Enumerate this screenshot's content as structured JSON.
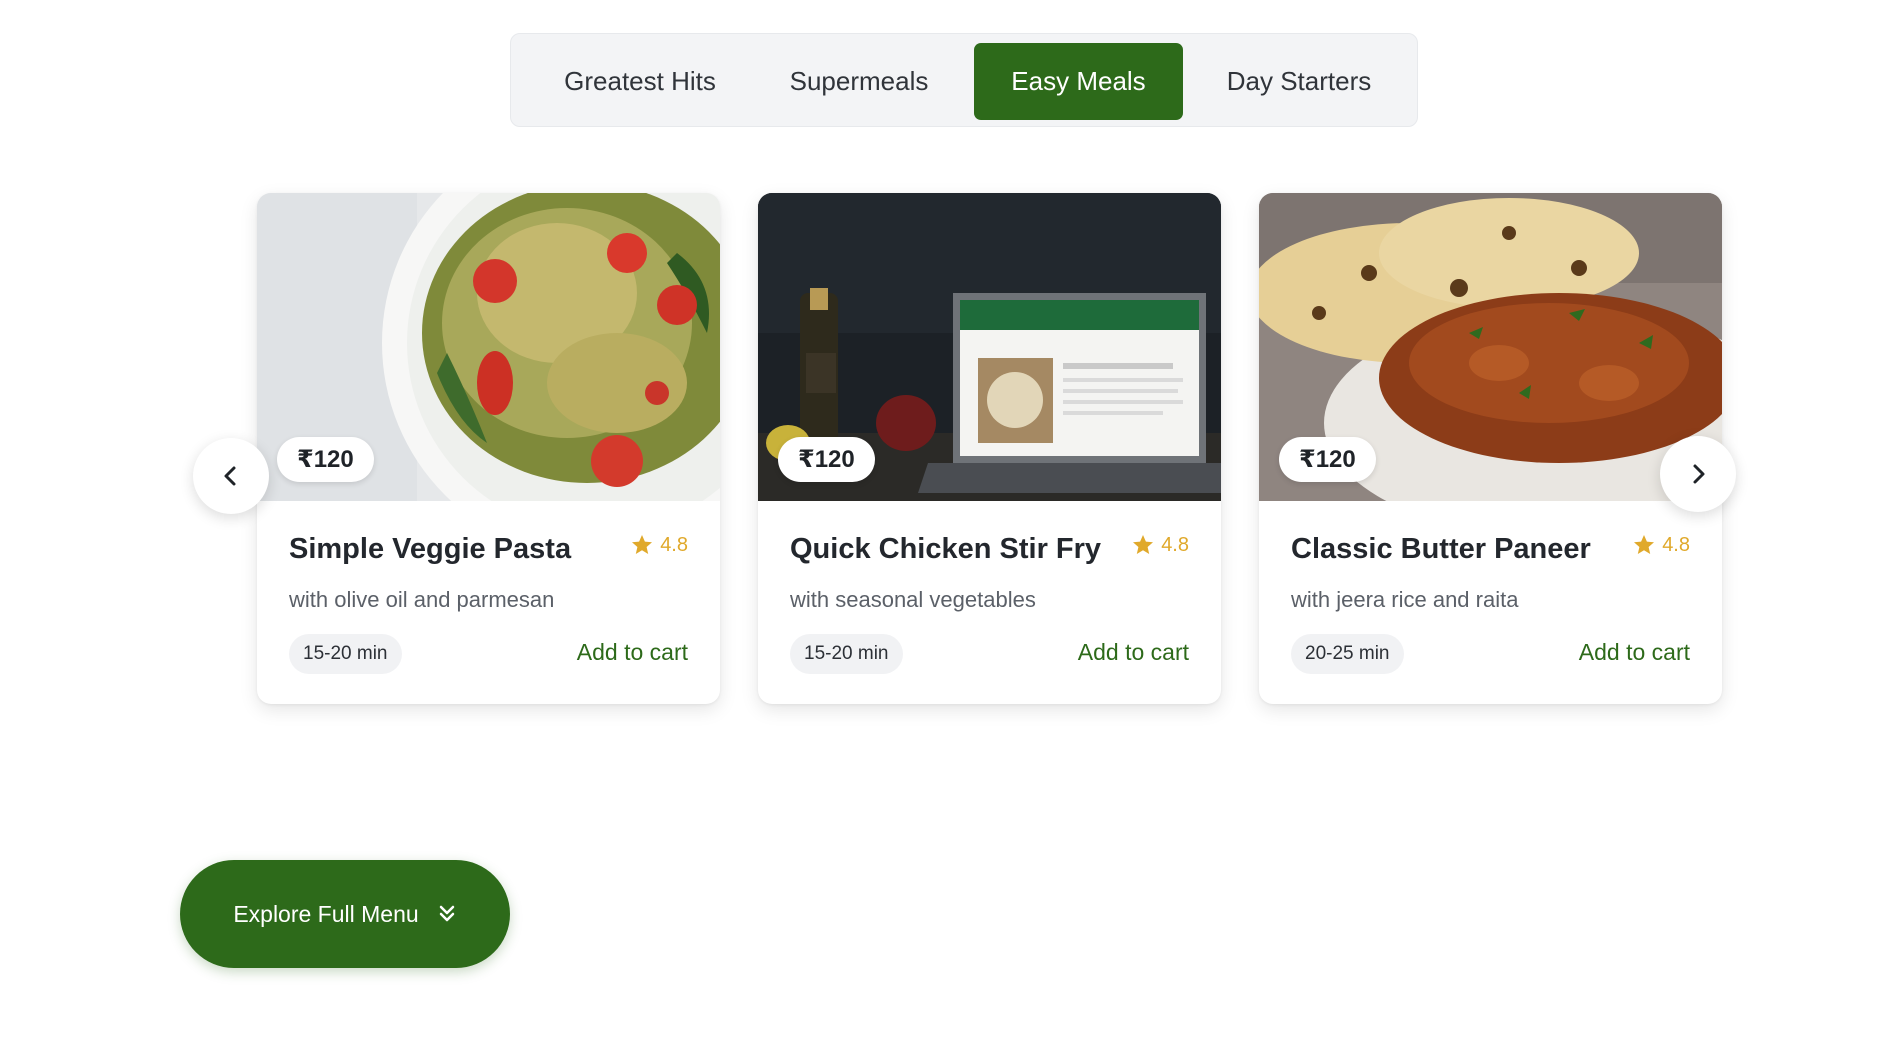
{
  "tabs": [
    {
      "label": "Greatest Hits",
      "active": false
    },
    {
      "label": "Supermeals",
      "active": false
    },
    {
      "label": "Easy Meals",
      "active": true
    },
    {
      "label": "Day Starters",
      "active": false
    }
  ],
  "cards": [
    {
      "price": "₹120",
      "title": "Simple Veggie Pasta",
      "rating": "4.8",
      "subtitle": "with olive oil and parmesan",
      "time": "15-20 min",
      "cart_label": "Add to cart",
      "image": "pasta-salad-bowl"
    },
    {
      "price": "₹120",
      "title": "Quick Chicken Stir Fry",
      "rating": "4.8",
      "subtitle": "with seasonal vegetables",
      "time": "15-20 min",
      "cart_label": "Add to cart",
      "image": "laptop-recipe-kitchen"
    },
    {
      "price": "₹120",
      "title": "Classic Butter Paneer",
      "rating": "4.8",
      "subtitle": "with jeera rice and raita",
      "time": "20-25 min",
      "cart_label": "Add to cart",
      "image": "curry-with-naan"
    }
  ],
  "carousel": {
    "prev_icon": "chevron-left-icon",
    "next_icon": "chevron-right-icon"
  },
  "explore_button": {
    "label": "Explore Full Menu",
    "icon": "double-chevron-down-icon"
  },
  "colors": {
    "brand_green": "#2d6a1a",
    "star": "#e0a92b",
    "tab_bg": "#f3f4f6"
  }
}
